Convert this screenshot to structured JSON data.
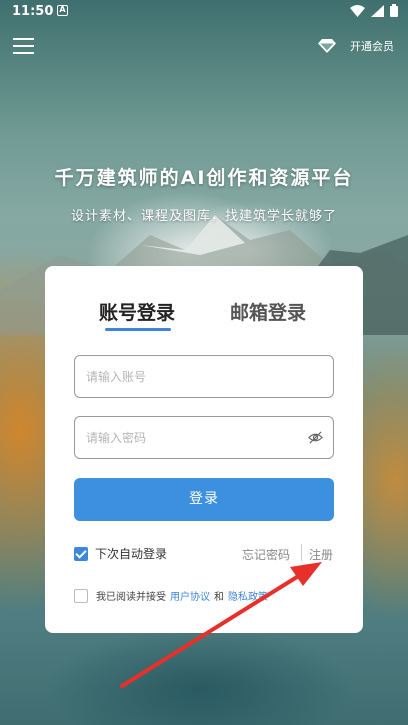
{
  "status_bar": {
    "time": "11:50",
    "notif_glyph": "A"
  },
  "topbar": {
    "menu_icon": "hamburger-icon",
    "vip_icon": "diamond-icon",
    "vip_label": "开通会员"
  },
  "hero": {
    "title": "千万建筑师的AI创作和资源平台",
    "subtitle": "设计素材、课程及图库，找建筑学长就够了"
  },
  "login": {
    "tabs": [
      {
        "label": "账号登录",
        "active": true
      },
      {
        "label": "邮箱登录",
        "active": false
      }
    ],
    "account_placeholder": "请输入账号",
    "password_placeholder": "请输入密码",
    "submit_label": "登录",
    "remember_label": "下次自动登录",
    "remember_checked": true,
    "forgot_label": "忘记密码",
    "register_label": "注册",
    "agreement": {
      "prefix": "我已阅读并接受",
      "user_agreement": "用户协议",
      "and": "和",
      "privacy_policy": "隐私政策",
      "checked": false
    }
  },
  "colors": {
    "accent": "#3d86d9",
    "button": "#3d90e0",
    "annotation_arrow": "#e8302a"
  }
}
